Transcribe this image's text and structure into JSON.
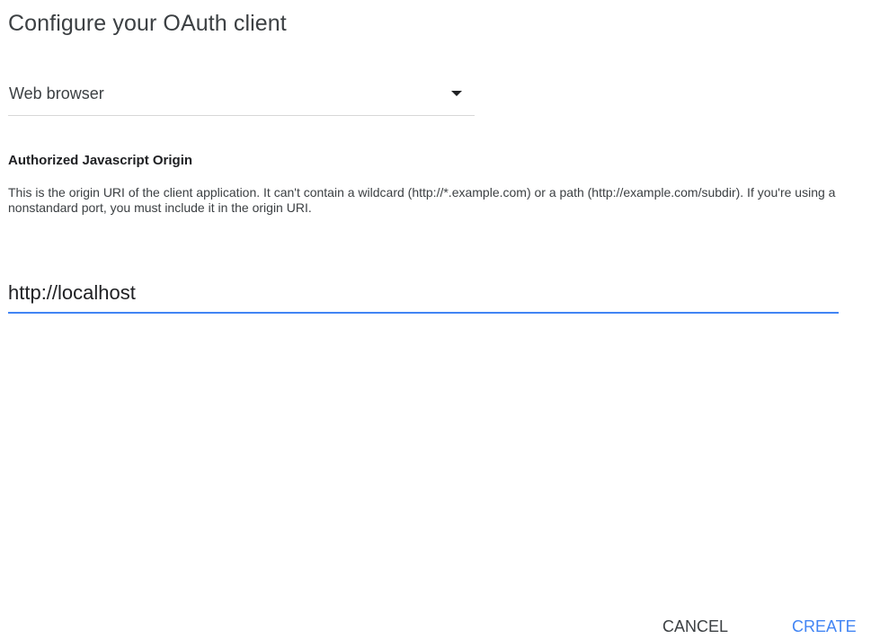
{
  "dialog": {
    "title": "Configure your OAuth client"
  },
  "client_type": {
    "selected": "Web browser"
  },
  "origin_section": {
    "heading": "Authorized Javascript Origin",
    "description": "This is the origin URI of the client application. It can't contain a wildcard (http://*.example.com) or a path (http://example.com/subdir). If you're using a nonstandard port, you must include it in the origin URI.",
    "value": "http://localhost"
  },
  "actions": {
    "cancel_label": "CANCEL",
    "create_label": "CREATE"
  },
  "colors": {
    "accent": "#4285f4",
    "text_primary": "#202124",
    "text_secondary": "#3c4043",
    "divider": "#d7d7d7"
  },
  "icons": {
    "dropdown": "dropdown-arrow-icon"
  }
}
